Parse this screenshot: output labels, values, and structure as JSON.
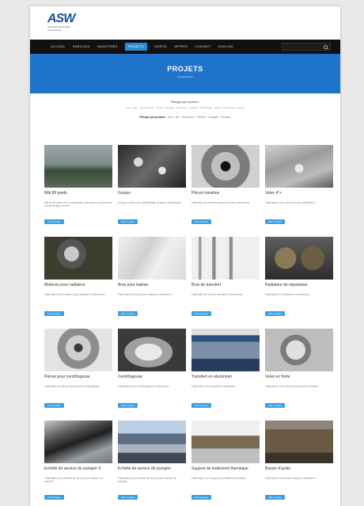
{
  "logo": {
    "mark": "ASW",
    "sub": "ATELIER SOUDURE WALLONNE"
  },
  "nav": {
    "items": [
      {
        "label": "Accueil",
        "active": false
      },
      {
        "label": "Services",
        "active": false
      },
      {
        "label": "Industries",
        "active": false
      },
      {
        "label": "Projets",
        "active": true
      },
      {
        "label": "Vidéos",
        "active": false
      },
      {
        "label": "Offres",
        "active": false
      },
      {
        "label": "Contact",
        "active": false
      },
      {
        "label": "English",
        "active": false
      }
    ],
    "search_icon": "search-icon"
  },
  "hero": {
    "title": "PROJETS",
    "crumb": "Accueil Projets"
  },
  "filters": {
    "label": "Filtrage par secteur :",
    "sectors": "Tous · Agro · Aéronautique · Chimie · Énergie · Ferroviaire · Industrie · Métallurgie · Naval · Pétrochimie · Spatial",
    "type_label": "Filtrage par produit :",
    "types": "Tous · Alu · Structures · Pièces · Usinage · Soudure"
  },
  "projects": [
    {
      "title": "Mât 80 pieds",
      "desc": "Mât de 80 pieds pour un particulier, fabrication en aluminium et assemblage sur site.",
      "button": "Voir le projet"
    },
    {
      "title": "Goujon",
      "desc": "Goujons usinés pour assemblage de pièces mécaniques.",
      "button": "Voir le projet"
    },
    {
      "title": "Pièces moulées",
      "desc": "Fabrication de diverses pièces en fonte d'aluminium.",
      "button": "Voir le projet"
    },
    {
      "title": "Valve 4\"+",
      "desc": "Fabrication d'une valve en fonte d'aluminium.",
      "button": "Voir le projet"
    },
    {
      "title": "Matrices pour radiateur",
      "desc": "Fabrication d'une matrice pour radiateur en aluminium.",
      "button": "Voir le projet"
    },
    {
      "title": "Bras pour bateau",
      "desc": "Fabrication d'un bras pour bateau en aluminium.",
      "button": "Voir le projet"
    },
    {
      "title": "Bras de transfert",
      "desc": "Fabrication de bras de transfert en aluminium.",
      "button": "Voir le projet"
    },
    {
      "title": "Radiateur de séparateur",
      "desc": "Fabrication d'un radiateur en aluminium.",
      "button": "Voir le projet"
    },
    {
      "title": "Pièces pour centrifugeuse",
      "desc": "Fabrication de pièces usinées pour centrifugeuse.",
      "button": "Voir le projet"
    },
    {
      "title": "Centrifugeuse",
      "desc": "Fabrication d'une centrifugeuse en aluminium.",
      "button": "Voir le projet"
    },
    {
      "title": "Transfert en aluminium",
      "desc": "Fabrication d'un transfert en aluminium.",
      "button": "Voir le projet"
    },
    {
      "title": "Valve en fonte",
      "desc": "Fabrication d'une valve en fonte pour l'industrie.",
      "button": "Voir le projet"
    },
    {
      "title": "Échelle de service de pompier 3",
      "desc": "Fabrication d'une échelle de service pour camion de pompier.",
      "button": "Voir le projet"
    },
    {
      "title": "Échelle de service de pompier",
      "desc": "Fabrication d'une échelle de service pour camion de pompier.",
      "button": "Voir le projet"
    },
    {
      "title": "Support de traitement thermique",
      "desc": "Fabrication d'un support de traitement thermique.",
      "button": "Voir le projet"
    },
    {
      "title": "Bassin d'acide",
      "desc": "Fabrication d'un bassin d'acide en aluminium.",
      "button": "Voir le projet"
    }
  ],
  "colors": {
    "accent": "#1e74c8",
    "nav_bg": "#111111",
    "button": "#39a0e2"
  }
}
